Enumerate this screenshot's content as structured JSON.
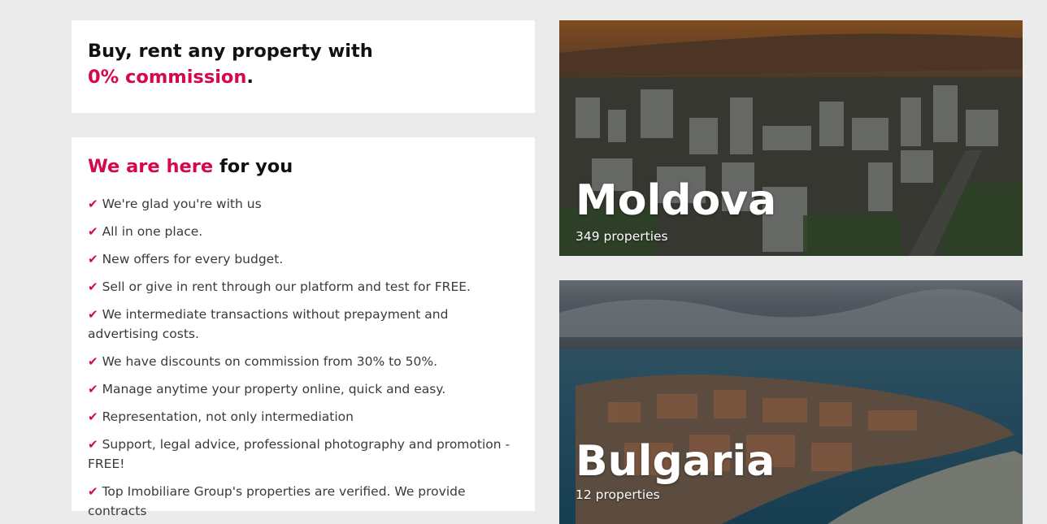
{
  "promo": {
    "title_line1": "Buy, rent any property with",
    "title_accent": "0% commission",
    "title_end": "."
  },
  "why": {
    "title_accent": "We are here",
    "title_rest": " for you",
    "check_icon": "check-icon",
    "items": [
      "We're glad you're with us",
      "All in one place.",
      "New offers for every budget.",
      "Sell or give in rent through our platform and test for FREE.",
      "We intermediate transactions without prepayment and advertising costs.",
      "We have discounts on commission from 30% to 50%.",
      "Manage anytime your property online, quick and easy.",
      "Representation, not only intermediation",
      "Support, legal advice, professional photography and promotion - FREE!",
      "Top Imobiliare Group's properties are verified. We provide contracts"
    ]
  },
  "destinations": [
    {
      "name": "Moldova",
      "count": "349 properties"
    },
    {
      "name": "Bulgaria",
      "count": "12 properties"
    }
  ],
  "colors": {
    "accent": "#d4084a",
    "background": "#ebebeb",
    "card": "#ffffff"
  }
}
